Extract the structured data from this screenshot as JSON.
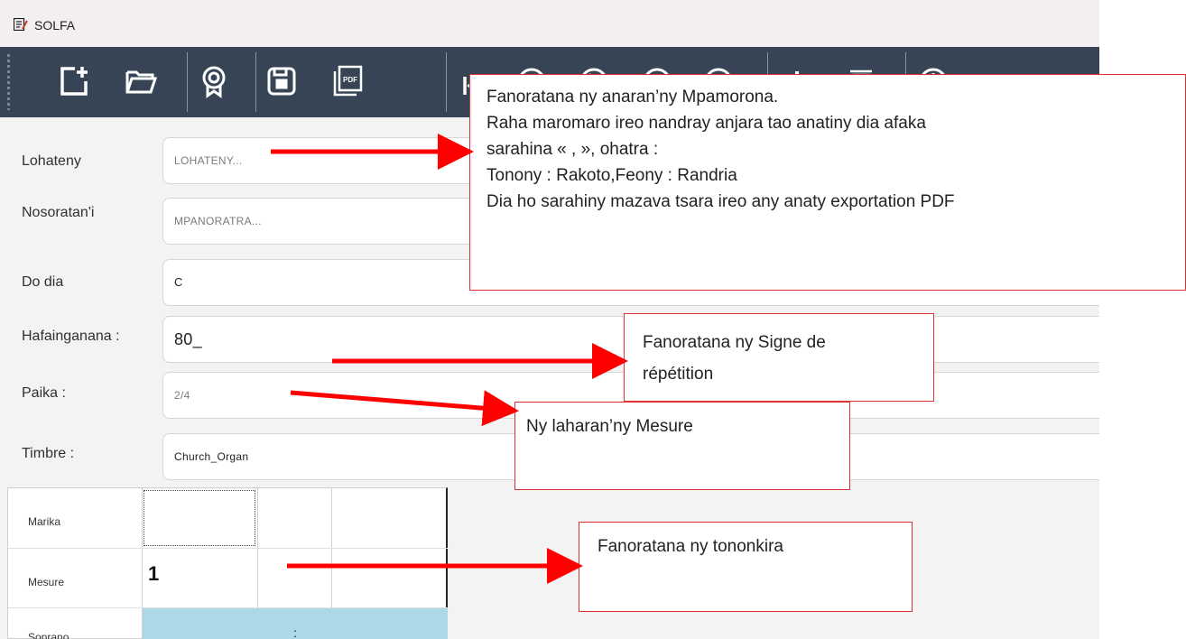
{
  "window": {
    "title": "SOLFA",
    "icon": "music-edit-icon"
  },
  "toolbar": {
    "buttons": [
      {
        "icon": "new-file-icon"
      },
      {
        "icon": "open-folder-icon"
      },
      {
        "icon": "award-icon"
      },
      {
        "icon": "save-icon"
      },
      {
        "icon": "pdf-export-icon",
        "text": "PDF"
      },
      {
        "icon": "skip-to-start-icon"
      },
      {
        "icon": "previous-icon"
      },
      {
        "icon": "play-icon"
      },
      {
        "icon": "next-icon"
      },
      {
        "icon": "stop-icon"
      },
      {
        "icon": "add-icon"
      },
      {
        "icon": "delete-icon"
      },
      {
        "icon": "info-icon"
      }
    ]
  },
  "form": {
    "title_label": "Lohateny",
    "title_placeholder": "LOHATENY...",
    "author_label": "Nosoratan'i",
    "author_placeholder": "MPANORATRA...",
    "key_label": "Do dia",
    "key_value": "C",
    "tempo_label": "Hafainganana :",
    "tempo_value": "80_",
    "meter_label": "Paika :",
    "meter_value": "2/4",
    "timbre_label": "Timbre :",
    "timbre_value": "Church_Organ"
  },
  "grid": {
    "rows": [
      "Marika",
      "Mesure",
      "Soprano"
    ],
    "measure_number": "1",
    "soprano_mark": ":"
  },
  "annotations": {
    "note1": [
      "Fanoratana ny anaran’ny Mpamorona.",
      "Raha maromaro ireo nandray anjara tao anatiny dia afaka",
      "sarahina « , », ohatra :",
      "Tonony : Rakoto,Feony : Randria",
      "Dia ho sarahiny mazava tsara ireo any anaty exportation PDF"
    ],
    "note2": [
      "Fanoratana ny Signe de",
      "répétition"
    ],
    "note3": "Ny laharan’ny Mesure",
    "note4": "Fanoratana ny tononkira",
    "arrow_color": "#ff0000"
  }
}
